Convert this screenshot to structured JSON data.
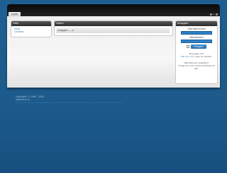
{
  "nav": {
    "home_tab": "HOME",
    "text_size": [
      "A",
      "A",
      "A"
    ]
  },
  "help": {
    "title": "Help",
    "links": [
      "Help",
      "Contact"
    ]
  },
  "home": {
    "title": "Home",
    "text": "Inloggen ---->"
  },
  "login": {
    "title": "Inloggen",
    "username_label": "Gebruikersnaam",
    "password_label": "Wachtwoord",
    "button": "Inloggen",
    "signup_text_1": "Nog geen lid?",
    "signup_link": "Klik hier",
    "signup_text_2": "om u aan te melden.",
    "forgot_text_1": "Wachtwoord vergeten?",
    "forgot_text_2": "Vraag",
    "forgot_link": "hier",
    "forgot_text_3": "een nieuw wachtwoord aan."
  },
  "footer": {
    "copyright": "Copyright © 2006 - 2024",
    "site": "www.seco.nl"
  },
  "colors": {
    "background": "#1c5b8c",
    "accent": "#2f7fc4",
    "panel_header": "#2b2b2b"
  }
}
